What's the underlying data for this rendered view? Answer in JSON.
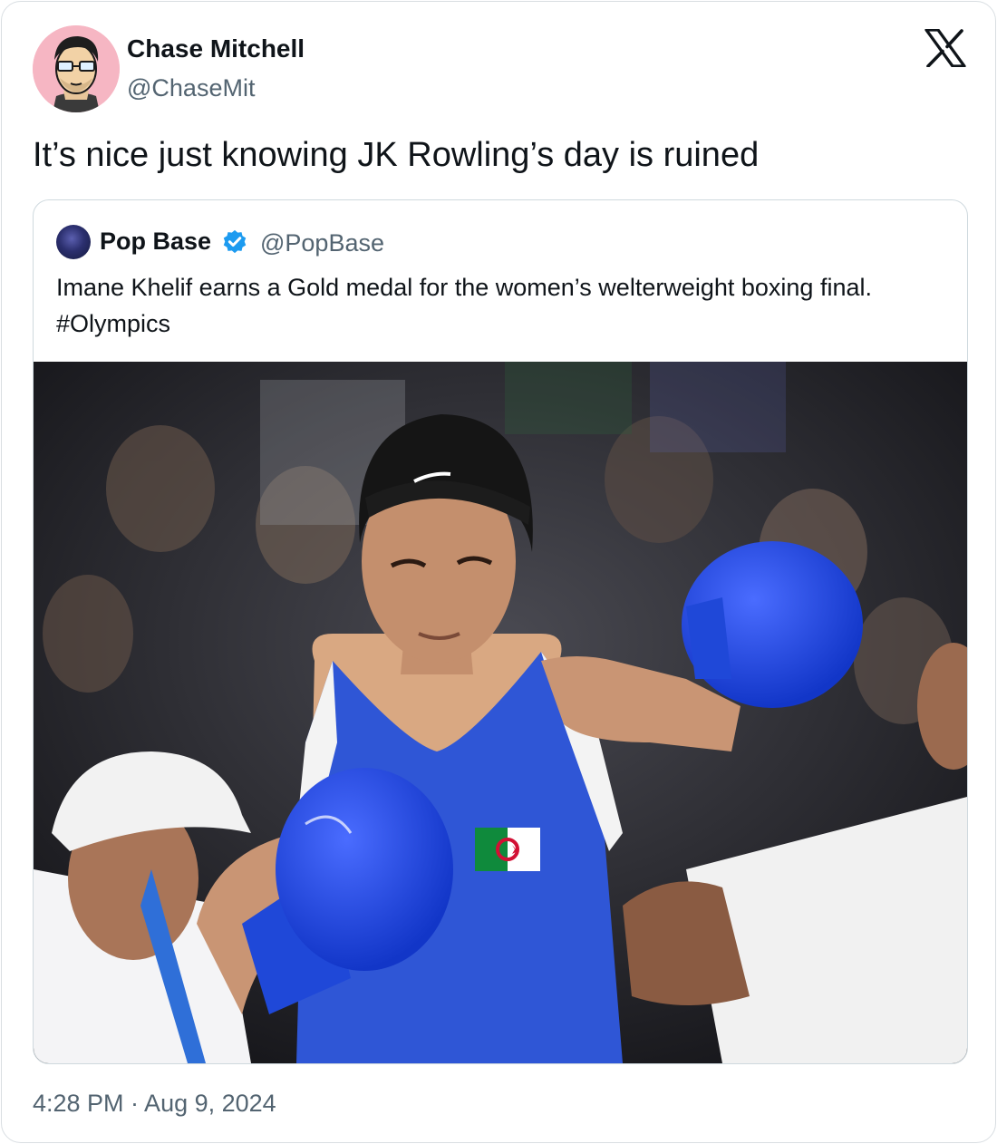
{
  "author": {
    "display_name": "Chase Mitchell",
    "handle": "@ChaseMit",
    "avatar_icon": "cartoon-face-avatar"
  },
  "platform_icon": "x-logo-icon",
  "tweet": {
    "text": "It’s nice just knowing JK Rowling’s day is ruined",
    "timestamp": "4:28 PM · Aug 9, 2024"
  },
  "quoted_tweet": {
    "display_name": "Pop Base",
    "verified": true,
    "handle": "@PopBase",
    "text": "Imane Khelif earns a Gold medal for the women’s welterweight boxing final. #Olympics",
    "photo": {
      "subject": "boxer in blue vest with blue gloves",
      "flag": "Algeria"
    }
  },
  "colors": {
    "text_primary": "#0f1419",
    "text_secondary": "#536471",
    "verified_blue": "#1d9bf0",
    "border": "#cfd9de"
  }
}
